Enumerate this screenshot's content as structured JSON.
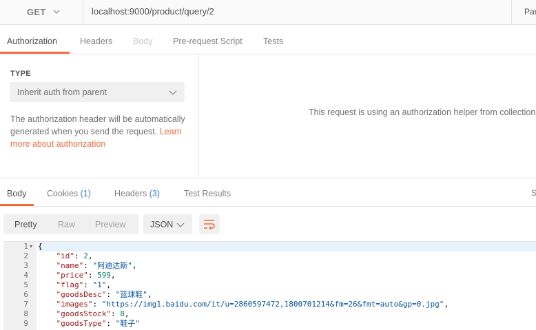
{
  "request": {
    "method": "GET",
    "url": "localhost:9000/product/query/2",
    "params_label": "Par"
  },
  "request_tabs": [
    {
      "label": "Authorization",
      "state": "active"
    },
    {
      "label": "Headers",
      "state": "normal"
    },
    {
      "label": "Body",
      "state": "disabled"
    },
    {
      "label": "Pre-request Script",
      "state": "normal"
    },
    {
      "label": "Tests",
      "state": "normal"
    }
  ],
  "auth": {
    "type_label": "TYPE",
    "type_value": "Inherit auth from parent",
    "description": "The authorization header will be automatically generated when you send the request.",
    "link": "Learn more about authorization",
    "helper_text": "This request is using an authorization helper from collection"
  },
  "response_tabs": {
    "body": "Body",
    "cookies": "Cookies",
    "cookies_count": "(1)",
    "headers": "Headers",
    "headers_count": "(3)",
    "test_results": "Test Results",
    "extra": "S"
  },
  "response_toolbar": {
    "views": [
      "Pretty",
      "Raw",
      "Preview"
    ],
    "active_view": "Pretty",
    "format": "JSON",
    "wrap_icon": "wrap-lines-icon"
  },
  "code": {
    "lines": [
      {
        "no": "1",
        "key": "",
        "value": "",
        "text": "{"
      },
      {
        "no": "2",
        "key": "\"id\"",
        "value": "2",
        "vtype": "n",
        "comma": ","
      },
      {
        "no": "3",
        "key": "\"name\"",
        "value": "\"阿迪达斯\"",
        "vtype": "s",
        "comma": ","
      },
      {
        "no": "4",
        "key": "\"price\"",
        "value": "599",
        "vtype": "n",
        "comma": ","
      },
      {
        "no": "5",
        "key": "\"flag\"",
        "value": "\"1\"",
        "vtype": "s",
        "comma": ","
      },
      {
        "no": "6",
        "key": "\"goodsDesc\"",
        "value": "\"篮球鞋\"",
        "vtype": "s",
        "comma": ","
      },
      {
        "no": "7",
        "key": "\"images\"",
        "value": "\"https://img1.baidu.com/it/u=2860597472,1800701214&fm=26&fmt=auto&gp=0.jpg\"",
        "vtype": "s",
        "comma": ","
      },
      {
        "no": "8",
        "key": "\"goodsStock\"",
        "value": "8",
        "vtype": "n",
        "comma": ","
      },
      {
        "no": "9",
        "key": "\"goodsType\"",
        "value": "\"鞋子\"",
        "vtype": "s",
        "comma": ""
      }
    ]
  },
  "colors": {
    "accent": "#f26b3a",
    "count": "#3b7ddd",
    "json_key": "#a31515",
    "json_string": "#0451a5",
    "json_number": "#098658"
  }
}
